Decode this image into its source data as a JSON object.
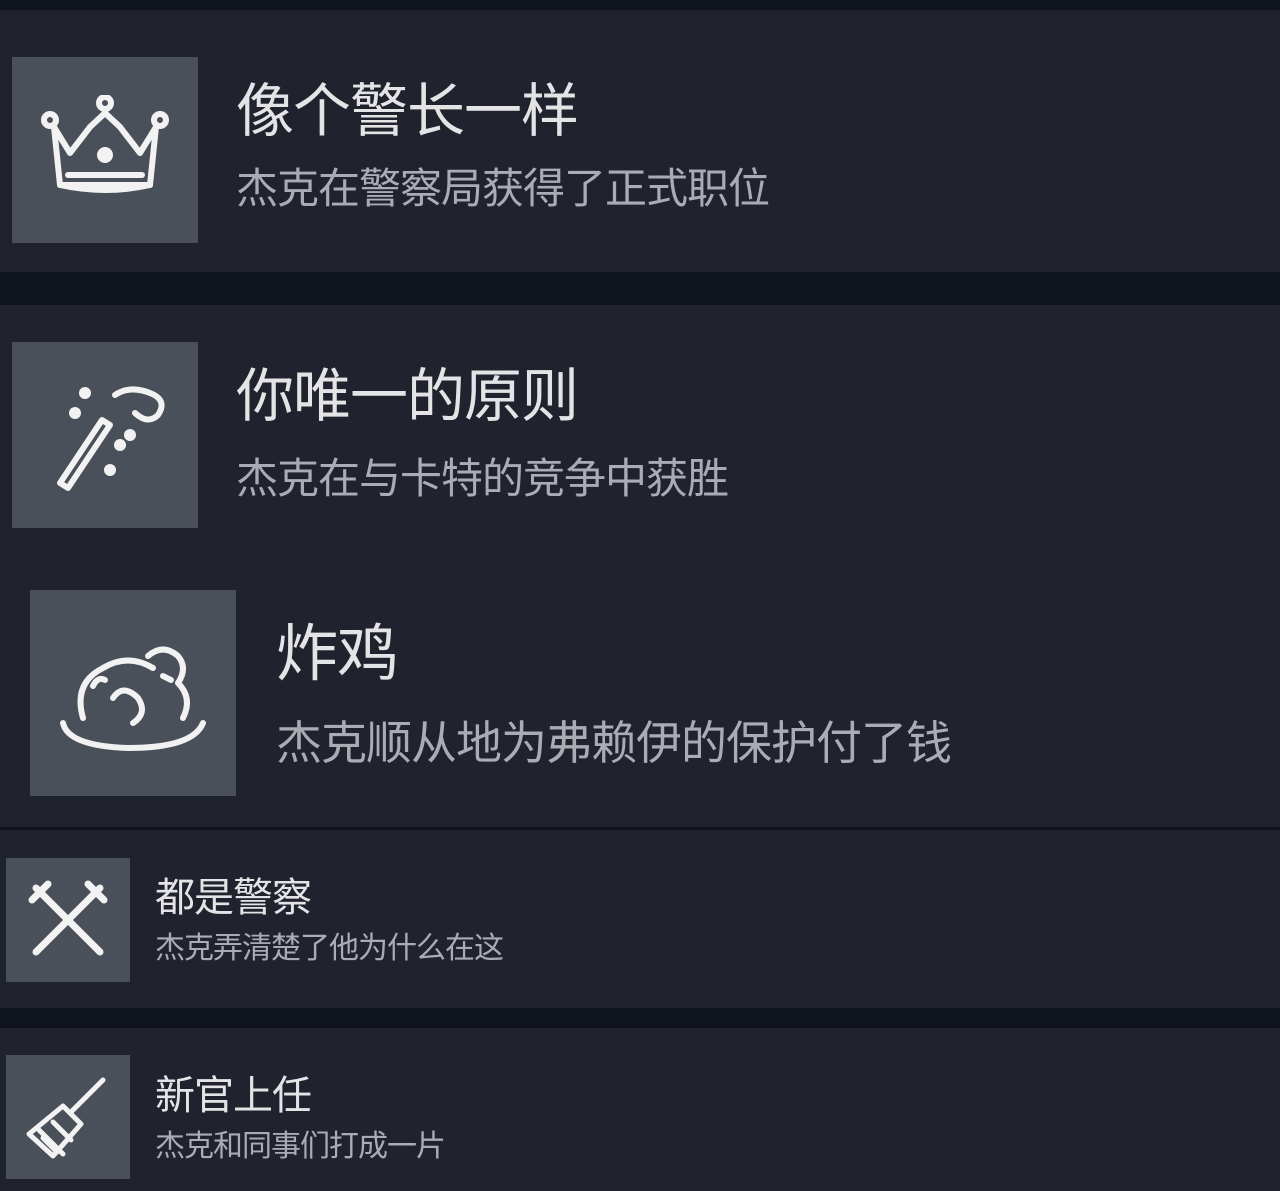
{
  "achievements": [
    {
      "title": "像个警长一样",
      "description": "杰克在警察局获得了正式职位",
      "icon": "crown-icon"
    },
    {
      "title": "你唯一的原则",
      "description": "杰克在与卡特的竞争中获胜",
      "icon": "magic-wand-icon"
    },
    {
      "title": "炸鸡",
      "description": "杰克顺从地为弗赖伊的保护付了钱",
      "icon": "roast-chicken-icon"
    },
    {
      "title": "都是警察",
      "description": "杰克弄清楚了他为什么在这",
      "icon": "crossed-batons-icon"
    },
    {
      "title": "新官上任",
      "description": "杰克和同事们打成一片",
      "icon": "broom-icon"
    }
  ],
  "colors": {
    "background": "#0f141c",
    "panel": "#20232e",
    "icon_tile": "#4a5059",
    "title_text": "#e4e4e6",
    "description_text": "#a9acb3"
  }
}
